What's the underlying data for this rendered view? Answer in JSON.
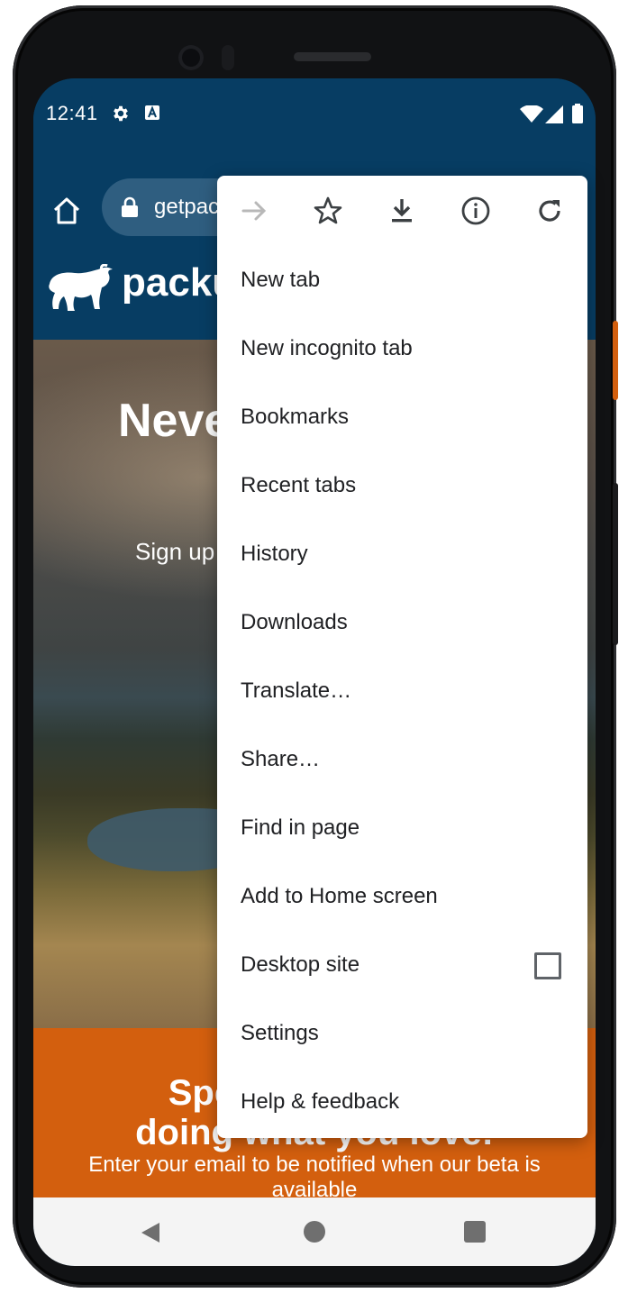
{
  "status": {
    "time": "12:41"
  },
  "toolbar": {
    "url": "getpackup.com"
  },
  "site": {
    "brand": "packup",
    "hero_title": "Never",
    "hero_sub": "Sign up",
    "banner_title_line1": "Spend more time",
    "banner_title_line2": "doing what you love!",
    "banner_sub": "Enter your email to be notified when our beta is available"
  },
  "menu": {
    "icons": [
      "forward-arrow-icon",
      "bookmark-star-icon",
      "download-icon",
      "page-info-icon",
      "reload-icon"
    ],
    "items": [
      "New tab",
      "New incognito tab",
      "Bookmarks",
      "Recent tabs",
      "History",
      "Downloads",
      "Translate…",
      "Share…",
      "Find in page",
      "Add to Home screen",
      "Desktop site",
      "Settings",
      "Help & feedback"
    ],
    "desktop_site_checked": false
  },
  "colors": {
    "header": "#073d63",
    "banner": "#d35f0e",
    "menu_text": "#202124"
  }
}
